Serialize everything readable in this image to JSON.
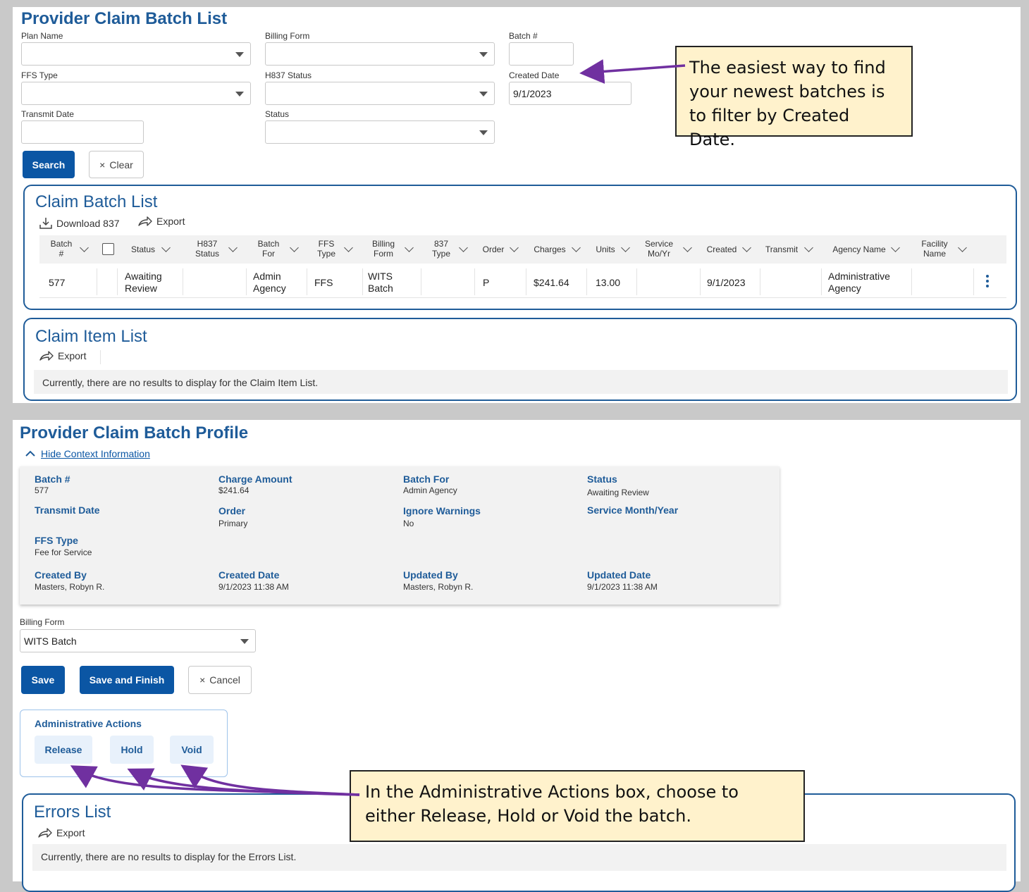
{
  "batch_list": {
    "title": "Provider Claim Batch List",
    "filters": {
      "plan_name": {
        "label": "Plan Name",
        "value": ""
      },
      "billing_form": {
        "label": "Billing Form",
        "value": ""
      },
      "batch_no": {
        "label": "Batch #",
        "value": ""
      },
      "ffs_type": {
        "label": "FFS Type",
        "value": ""
      },
      "h837_status": {
        "label": "H837 Status",
        "value": ""
      },
      "created_date": {
        "label": "Created Date",
        "value": "9/1/2023"
      },
      "transmit_date": {
        "label": "Transmit Date",
        "value": ""
      },
      "status": {
        "label": "Status",
        "value": ""
      }
    },
    "search_label": "Search",
    "clear_label": "Clear",
    "callout": "The easiest way to find your newest batches is to filter by Created Date."
  },
  "claim_batch_list": {
    "title": "Claim Batch List",
    "download_label": "Download 837",
    "export_label": "Export",
    "columns": [
      "Batch #",
      "Status",
      "H837 Status",
      "Batch For",
      "FFS Type",
      "Billing Form",
      "837 Type",
      "Order",
      "Charges",
      "Units",
      "Service Mo/Yr",
      "Created",
      "Transmit",
      "Agency Name",
      "Facility Name"
    ],
    "rows": [
      {
        "batch": "577",
        "status": "Awaiting Review",
        "h837": "",
        "batch_for": "Admin Agency",
        "ffs": "FFS",
        "billing_form": "WITS Batch",
        "type837": "",
        "order": "P",
        "charges": "$241.64",
        "units": "13.00",
        "service": "",
        "created": "9/1/2023",
        "transmit": "",
        "agency": "Administrative Agency",
        "facility": ""
      }
    ]
  },
  "claim_item_list": {
    "title": "Claim Item List",
    "export_label": "Export",
    "empty_text": "Currently, there are no results to display for the Claim Item List."
  },
  "profile": {
    "title": "Provider Claim Batch Profile",
    "hide_context": "Hide Context Information",
    "fields": [
      {
        "label": "Batch #",
        "value": "577"
      },
      {
        "label": "Charge Amount",
        "value": "$241.64"
      },
      {
        "label": "Batch For",
        "value": "Admin Agency"
      },
      {
        "label": "Status",
        "value": "Awaiting Review"
      },
      {
        "label": "Transmit Date",
        "value": ""
      },
      {
        "label": "Order",
        "value": "Primary"
      },
      {
        "label": "Ignore Warnings",
        "value": "No"
      },
      {
        "label": "Service Month/Year",
        "value": ""
      },
      {
        "label": "FFS Type",
        "value": "Fee for Service"
      },
      {
        "label": "Created By",
        "value": "Masters, Robyn R."
      },
      {
        "label": "Created Date",
        "value": "9/1/2023 11:38 AM"
      },
      {
        "label": "Updated By",
        "value": "Masters, Robyn R."
      },
      {
        "label": "Updated Date",
        "value": "9/1/2023 11:38 AM"
      }
    ],
    "billing_form": {
      "label": "Billing Form",
      "value": "WITS Batch"
    },
    "save_label": "Save",
    "save_finish_label": "Save and Finish",
    "cancel_label": "Cancel",
    "admin_actions": {
      "title": "Administrative Actions",
      "release": "Release",
      "hold": "Hold",
      "void": "Void"
    },
    "callout": "In the Administrative Actions box, choose to either Release, Hold or Void the batch."
  },
  "errors_list": {
    "title": "Errors List",
    "export_label": "Export",
    "empty_text": "Currently, there are no results to display for the Errors List."
  },
  "colors": {
    "brand": "#1f5c99",
    "primary_button": "#0b56a4",
    "callout_fill": "#fff2cc",
    "arrow": "#7030a0"
  }
}
